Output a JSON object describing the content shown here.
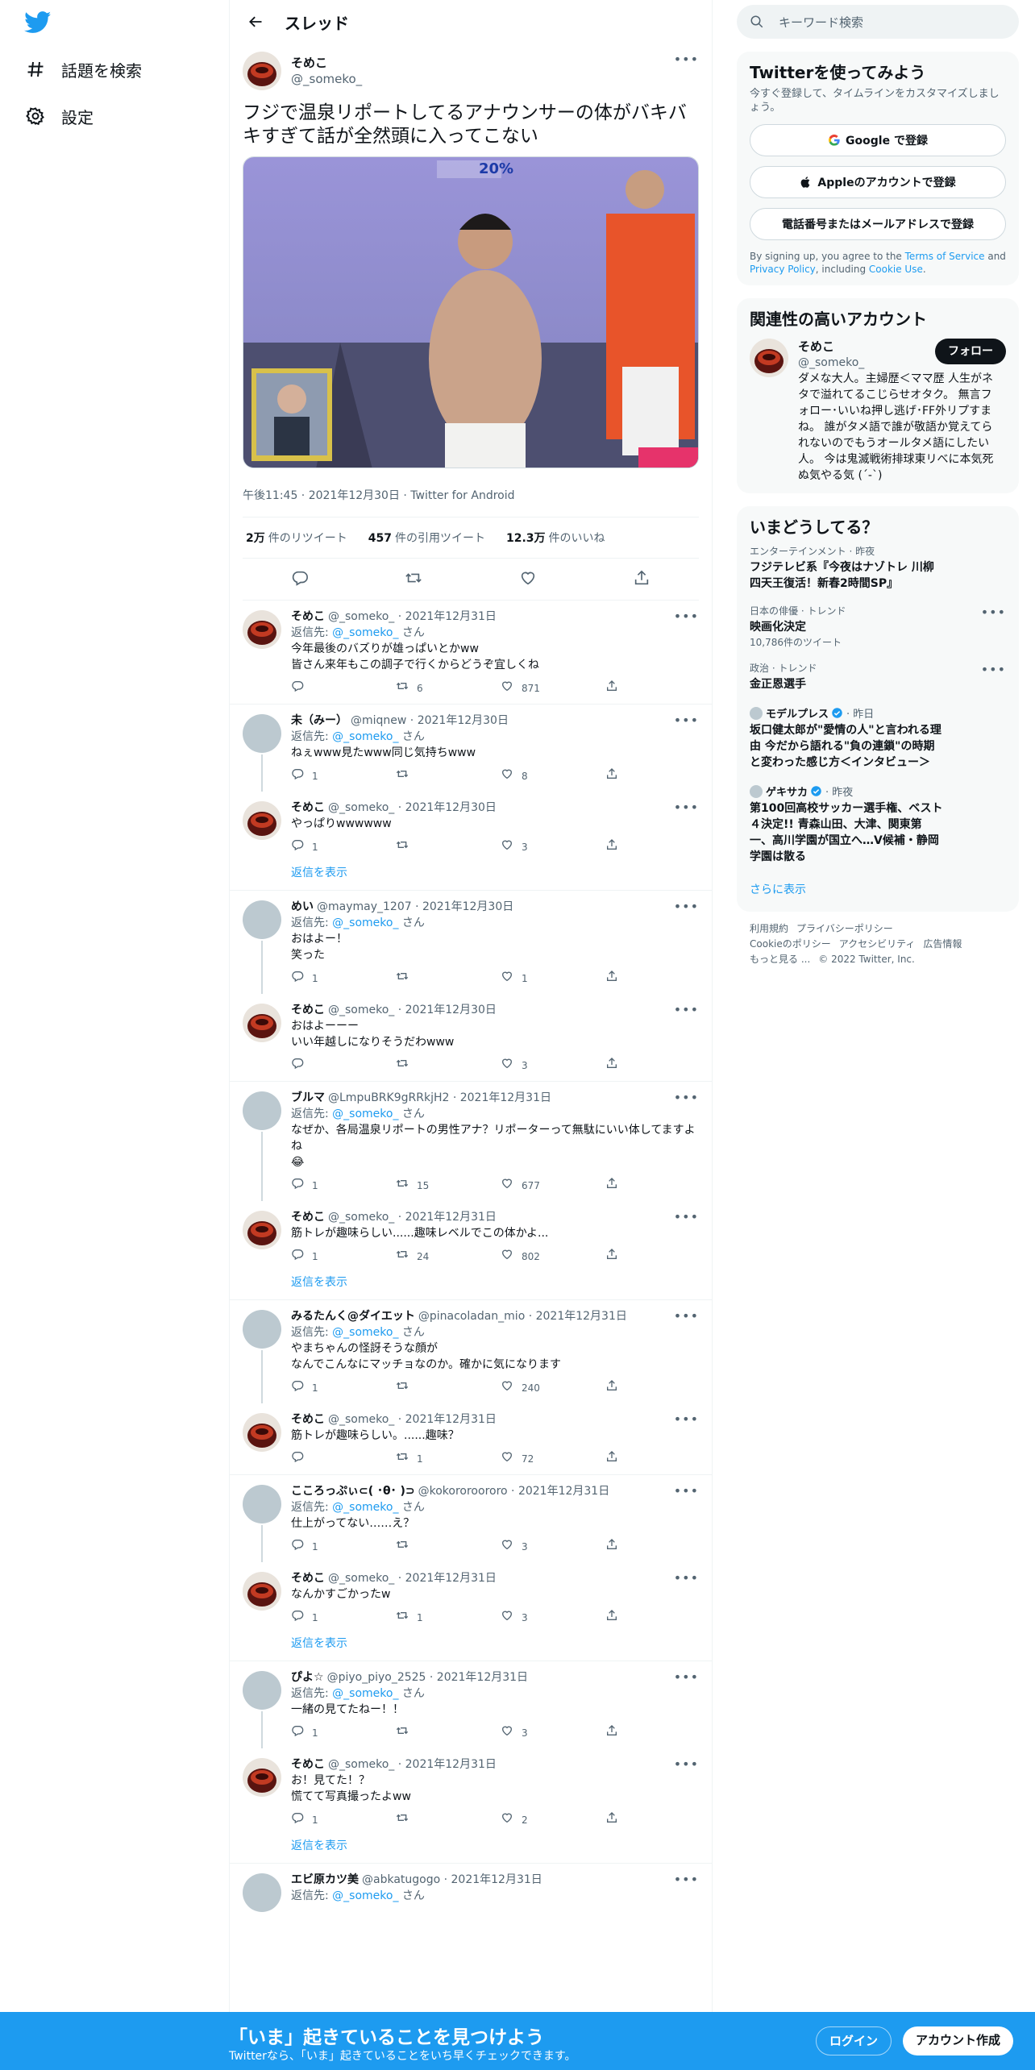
{
  "nav": {
    "explore": "話題を検索",
    "settings": "設定"
  },
  "header": {
    "title": "スレッド"
  },
  "focal": {
    "name": "そめこ",
    "handle": "@_someko_",
    "text": "フジで温泉リポートしてるアナウンサーの体がバキバキすぎて話が全然頭に入ってこない",
    "media_overlay_pct": "20%",
    "meta": "午後11:45 · 2021年12月30日 · Twitter for Android",
    "retweets_num": "2万",
    "retweets_label": "件のリツイート",
    "quotes_num": "457",
    "quotes_label": "件の引用ツイート",
    "likes_num": "12.3万",
    "likes_label": "件のいいね"
  },
  "replies": [
    {
      "name": "そめこ",
      "meta": "@_someko_ · 2021年12月31日",
      "replyto_label": "返信先:",
      "replyto": "@_someko_",
      "replyto_suffix": "さん",
      "text": "今年最後のバズりが雄っぱいとかww\n皆さん来年もこの調子で行くからどうぞ宜しくね",
      "reply": "",
      "rt": "6",
      "like": "871"
    },
    {
      "name": "未（みー）",
      "meta": "@miqnew · 2021年12月30日",
      "replyto_label": "返信先:",
      "replyto": "@_someko_",
      "replyto_suffix": "さん",
      "text": "ねぇwww見たwww同じ気持ちwww",
      "reply": "1",
      "rt": "",
      "like": "8"
    },
    {
      "name": "そめこ",
      "meta": "@_someko_ · 2021年12月30日",
      "text": "やっぱりwwwwww",
      "reply": "1",
      "rt": "",
      "like": "3",
      "show_replies": "返信を表示"
    },
    {
      "name": "めい",
      "meta": "@maymay_1207 · 2021年12月30日",
      "replyto_label": "返信先:",
      "replyto": "@_someko_",
      "replyto_suffix": "さん",
      "text": "おはよー！\n笑った",
      "reply": "1",
      "rt": "",
      "like": "1"
    },
    {
      "name": "そめこ",
      "meta": "@_someko_ · 2021年12月30日",
      "text": "おはよーーー\nいい年越しになりそうだわwww",
      "reply": "",
      "rt": "",
      "like": "3"
    },
    {
      "name": "ブルマ",
      "meta": "@LmpuBRK9gRRkjH2 · 2021年12月31日",
      "replyto_label": "返信先:",
      "replyto": "@_someko_",
      "replyto_suffix": "さん",
      "text": "なぜか、各局温泉リポートの男性アナ？リポーターって無駄にいい体してますよね\n😂",
      "reply": "1",
      "rt": "15",
      "like": "677"
    },
    {
      "name": "そめこ",
      "meta": "@_someko_ · 2021年12月31日",
      "text": "筋トレが趣味らしい......趣味レベルでこの体かよ...",
      "reply": "1",
      "rt": "24",
      "like": "802",
      "show_replies": "返信を表示"
    },
    {
      "name": "みるたんく@ダイエット",
      "meta": "@pinacoladan_mio · 2021年12月31日",
      "replyto_label": "返信先:",
      "replyto": "@_someko_",
      "replyto_suffix": "さん",
      "text": "やまちゃんの怪訝そうな顔が\nなんでこんなにマッチョなのか。確かに気になります",
      "reply": "1",
      "rt": "",
      "like": "240"
    },
    {
      "name": "そめこ",
      "meta": "@_someko_ · 2021年12月31日",
      "text": "筋トレが趣味らしい。......趣味？",
      "reply": "",
      "rt": "1",
      "like": "72"
    },
    {
      "name": "こころっぷぃ⊂( ･θ･ )⊃",
      "meta": "@kokororoororo · 2021年12月31日",
      "replyto_label": "返信先:",
      "replyto": "@_someko_",
      "replyto_suffix": "さん",
      "text": "仕上がってない……え？",
      "reply": "1",
      "rt": "",
      "like": "3"
    },
    {
      "name": "そめこ",
      "meta": "@_someko_ · 2021年12月31日",
      "text": "なんかすごかったw",
      "reply": "1",
      "rt": "1",
      "like": "3",
      "show_replies": "返信を表示"
    },
    {
      "name": "ぴよ☆",
      "meta": "@piyo_piyo_2525 · 2021年12月31日",
      "replyto_label": "返信先:",
      "replyto": "@_someko_",
      "replyto_suffix": "さん",
      "text": "一緒の見てたねー！！",
      "reply": "1",
      "rt": "",
      "like": "3"
    },
    {
      "name": "そめこ",
      "meta": "@_someko_ · 2021年12月31日",
      "text": "お！見てた！？\n慌てて写真撮ったよww",
      "reply": "1",
      "rt": "",
      "like": "2",
      "show_replies": "返信を表示"
    },
    {
      "name": "エビ原カツ美",
      "meta": "@abkatugogo · 2021年12月31日",
      "replyto_label": "返信先:",
      "replyto": "@_someko_",
      "replyto_suffix": "さん",
      "text": "",
      "reply": "",
      "rt": "",
      "like": ""
    }
  ],
  "search": {
    "placeholder": "キーワード検索"
  },
  "signup": {
    "title": "Twitterを使ってみよう",
    "sub": "今すぐ登録して、タイムラインをカスタマイズしましょう。",
    "google": "Google で登録",
    "apple": "Appleのアカウントで登録",
    "phone": "電話番号またはメールアドレスで登録",
    "legal_pre": "By signing up, you agree to the ",
    "tos": "Terms of Service",
    "and": " and ",
    "privacy": "Privacy Policy",
    "including": ", including ",
    "cookie": "Cookie Use",
    "period": "."
  },
  "related": {
    "title": "関連性の高いアカウント",
    "name": "そめこ",
    "handle": "@_someko_",
    "follow": "フォロー",
    "bio": "ダメな大人。主婦歴＜ママ歴 人生がネタで溢れてるこじらせオタク。 無言フォロー･いいね押し逃げ･FF外リプすまね。 誰がタメ語で誰が敬語か覚えてられないのでもうオールタメ語にしたい人。 今は鬼滅戦術排球東リべに本気死ぬ気やる気 (´-`)"
  },
  "trends": {
    "title": "いまどうしてる？",
    "items": [
      {
        "cat": "エンターテインメント · 昨夜",
        "title": "フジテレビ系『今夜はナゾトレ 川柳四天王復活！新春2時間SP』",
        "count": ""
      },
      {
        "cat": "日本の俳優 · トレンド",
        "title": "映画化決定",
        "count": "10,786件のツイート"
      },
      {
        "cat": "政治 · トレンド",
        "title": "金正恩選手",
        "count": ""
      }
    ],
    "news": [
      {
        "src": "モデルプレス",
        "time": "· 昨日",
        "title": "坂口健太郎が\"愛情の人\"と言われる理由 今だから語れる\"負の連鎖\"の時期と変わった感じ方＜インタビュー＞"
      },
      {
        "src": "ゲキサカ",
        "time": "· 昨夜",
        "title": "第100回高校サッカー選手権、ベスト４決定!! 青森山田、大津、関東第一、高川学園が国立へ…V候補・静岡学園は散る"
      }
    ],
    "show_more": "さらに表示"
  },
  "footer": {
    "terms": "利用規約",
    "privacy": "プライバシーポリシー",
    "cookie": "Cookieのポリシー",
    "access": "アクセシビリティ",
    "ads": "広告情報",
    "more": "もっと見る ...",
    "copy": "© 2022 Twitter, Inc."
  },
  "bottom": {
    "title": "「いま」起きていることを見つけよう",
    "sub": "Twitterなら、「いま」起きていることをいち早くチェックできます。",
    "login": "ログイン",
    "signup": "アカウント作成"
  },
  "colors": {
    "accent": "#1d9bf0",
    "text": "#0f1419",
    "muted": "#536471"
  }
}
